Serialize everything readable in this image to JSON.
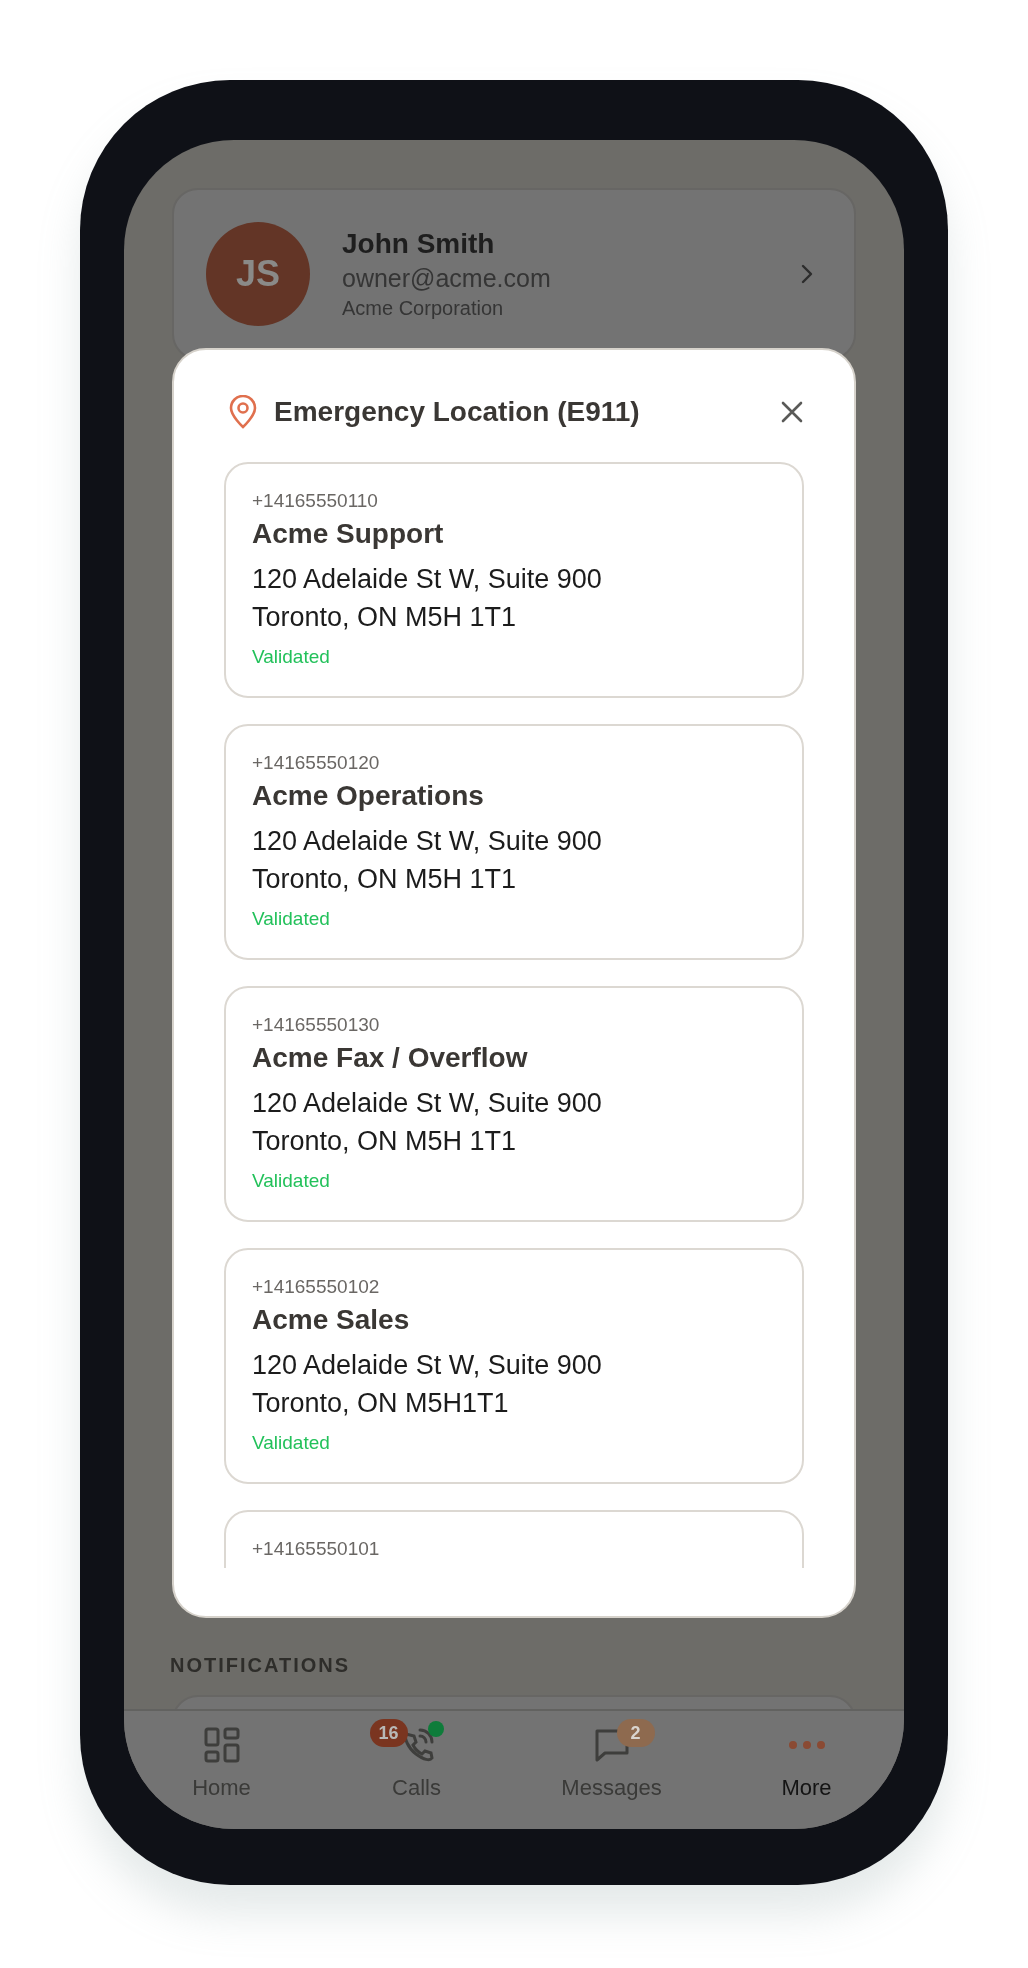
{
  "profile": {
    "initials": "JS",
    "name": "John Smith",
    "email": "owner@acme.com",
    "company": "Acme Corporation"
  },
  "modal": {
    "title": "Emergency Location (E911)",
    "locations": [
      {
        "number": "+14165550110",
        "name": "Acme Support",
        "address_line_1": "120 Adelaide St W, Suite 900",
        "address_line_2": "Toronto, ON M5H 1T1",
        "status": "Validated"
      },
      {
        "number": "+14165550120",
        "name": "Acme Operations",
        "address_line_1": "120 Adelaide St W, Suite 900",
        "address_line_2": "Toronto, ON M5H 1T1",
        "status": "Validated"
      },
      {
        "number": "+14165550130",
        "name": "Acme Fax / Overflow",
        "address_line_1": "120 Adelaide St W, Suite 900",
        "address_line_2": "Toronto, ON M5H 1T1",
        "status": "Validated"
      },
      {
        "number": "+14165550102",
        "name": "Acme Sales",
        "address_line_1": "120 Adelaide St W, Suite 900",
        "address_line_2": "Toronto, ON M5H1T1",
        "status": "Validated"
      },
      {
        "number": "+14165550101"
      }
    ]
  },
  "section_label": "NOTIFICATIONS",
  "nav": [
    {
      "kind": "home",
      "label": "Home",
      "selected": false
    },
    {
      "kind": "calls",
      "label": "Calls",
      "selected": false,
      "badge": "16",
      "online": true
    },
    {
      "kind": "messages",
      "label": "Messages",
      "selected": false,
      "badge": "2"
    },
    {
      "kind": "more",
      "label": "More",
      "selected": true
    }
  ]
}
